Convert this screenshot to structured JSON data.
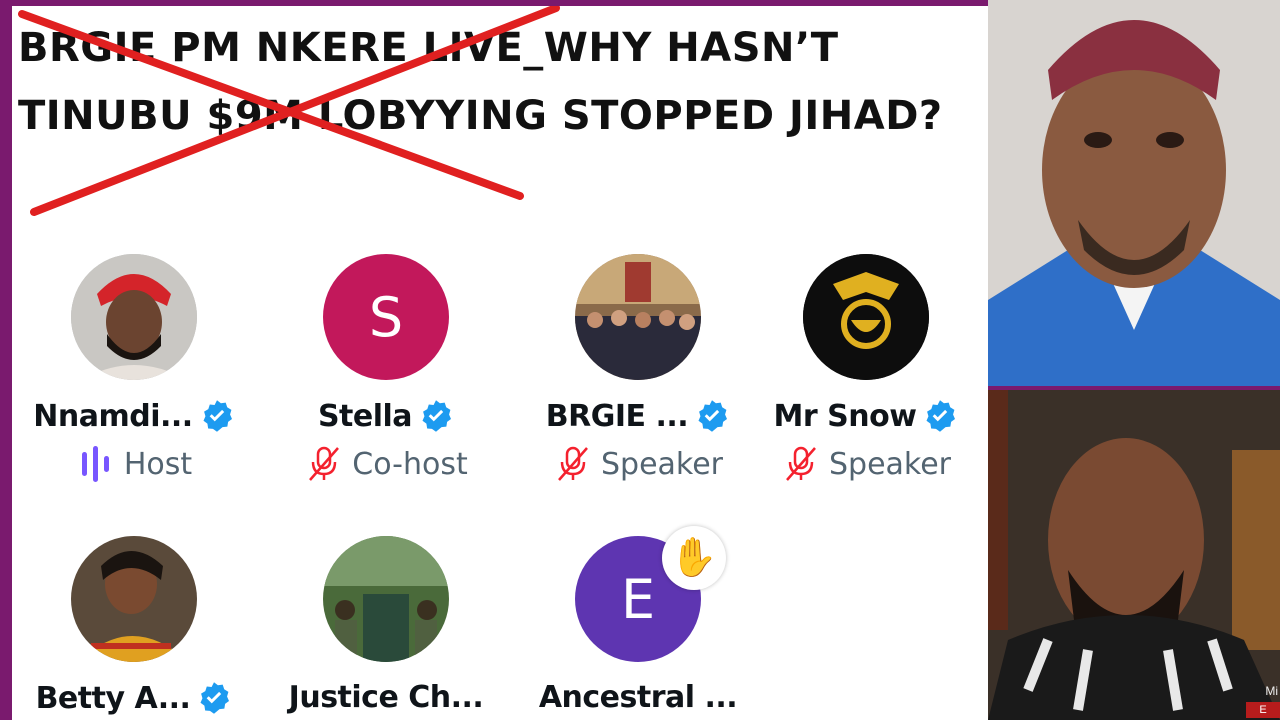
{
  "title": "BRGIE PM NKERE LIVE_WHY HASN’T TINUBU $9M LOBYYING STOPPED JIHAD?",
  "colors": {
    "frame": "#7a1a6e",
    "strike": "#e02020",
    "verified": "#1d9bf0",
    "host": "#7856ff",
    "muted": "#f4212e"
  },
  "participants": [
    {
      "name": "Nnamdi...",
      "role": "Host",
      "role_icon": "host-equalizer-icon",
      "verified": true
    },
    {
      "name": "Stella",
      "role": "Co-host",
      "role_icon": "mic-off-icon",
      "verified": true,
      "avatar_letter": "S",
      "avatar_color": "#c2185b"
    },
    {
      "name": "BRGIE ...",
      "role": "Speaker",
      "role_icon": "mic-off-icon",
      "verified": true
    },
    {
      "name": "Mr Snow",
      "role": "Speaker",
      "role_icon": "mic-off-icon",
      "verified": true
    },
    {
      "name": "Betty A...",
      "verified": true
    },
    {
      "name": "Justice Ch..."
    },
    {
      "name": "Ancestral ...",
      "avatar_letter": "E",
      "avatar_color": "#5e35b1",
      "hand_raised": true,
      "hand_icon": "✋"
    }
  ],
  "camera": {
    "label": "Mi",
    "badge": "E"
  }
}
